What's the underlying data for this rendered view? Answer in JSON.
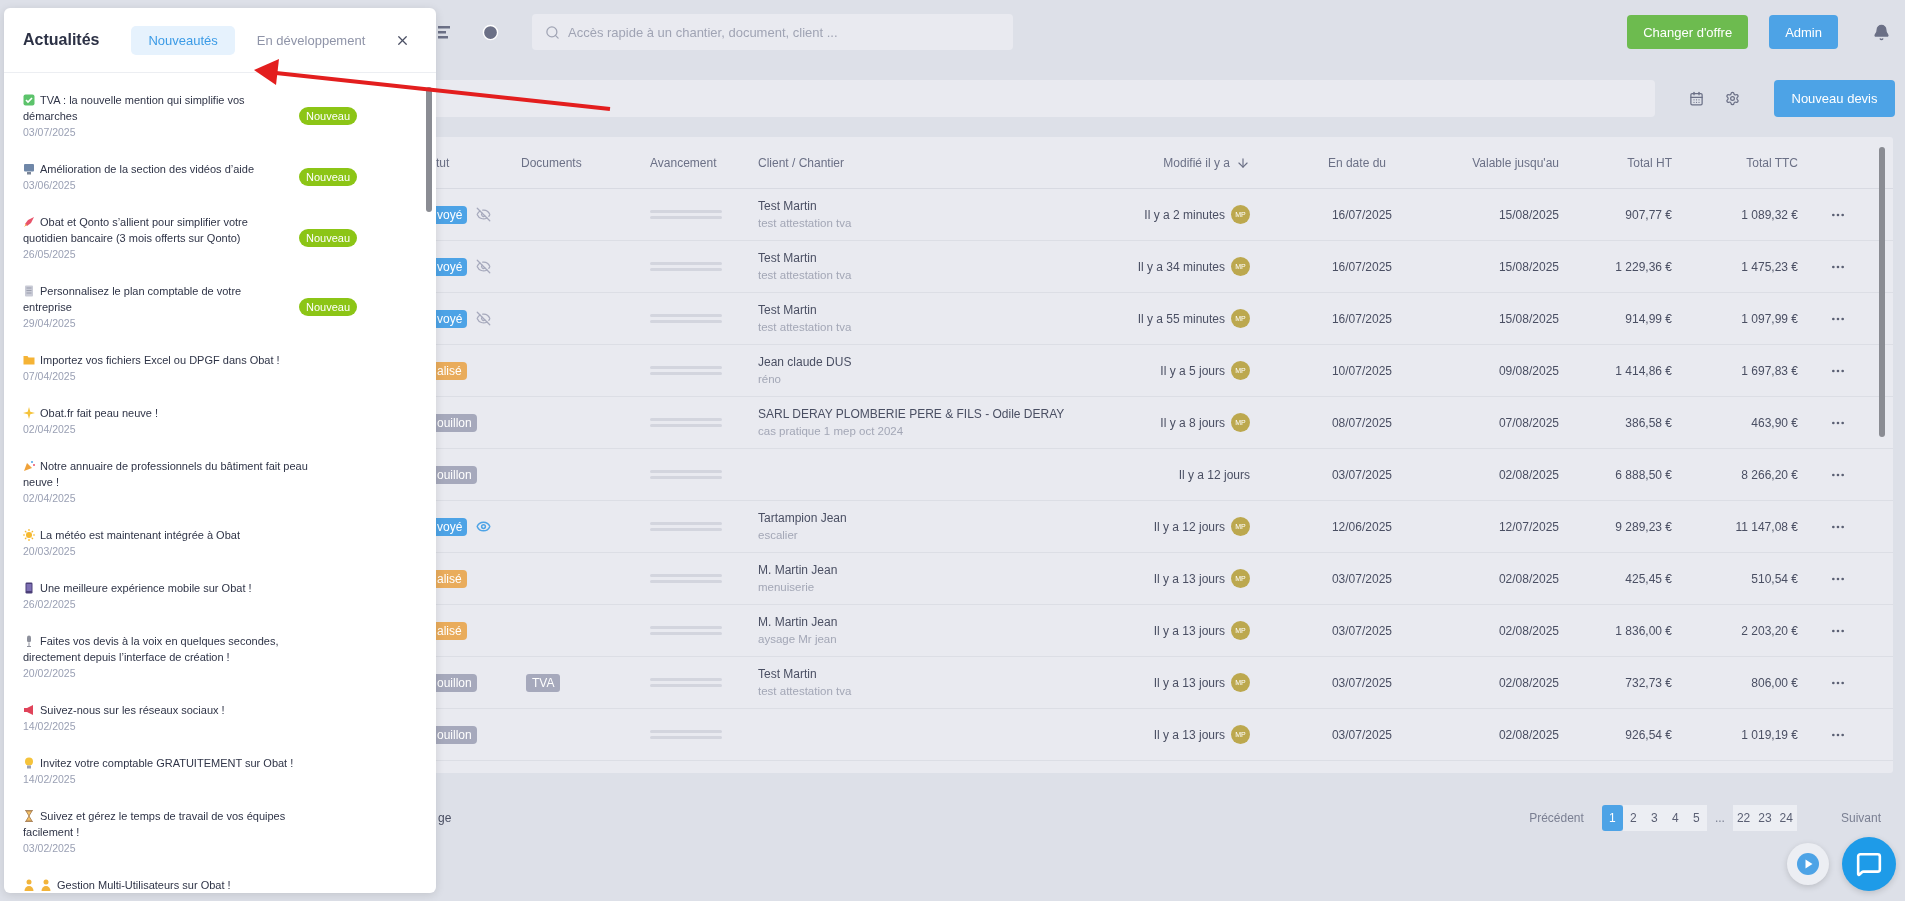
{
  "topbar": {
    "search": {
      "placeholder": "Accès rapide à un chantier, document, client ..."
    },
    "buttons": [
      {
        "label": "Changer d'offre",
        "kind": "upgrade"
      },
      {
        "label": "Admin",
        "kind": "admin"
      }
    ]
  },
  "toolbar": {
    "button": "Nouveau devis"
  },
  "table": {
    "columns": [
      {
        "label": "tut",
        "sorted": false
      },
      {
        "label": "Documents",
        "sorted": false
      },
      {
        "label": "Avancement",
        "sorted": false
      },
      {
        "label": "Client / Chantier",
        "sorted": false
      },
      {
        "label": "Modifié il y a",
        "sorted": true
      },
      {
        "label": "En date du",
        "sorted": false
      },
      {
        "label": "Valable jusqu'au",
        "sorted": false
      },
      {
        "label": "Total HT",
        "sorted": false
      },
      {
        "label": "Total TTC",
        "sorted": false
      }
    ],
    "rows": [
      {
        "status": {
          "label": "voyé",
          "color": "#4da3e6"
        },
        "seen": false,
        "client": "Test Martin",
        "site": "test attestation tva",
        "modified": "Il y a 2 minutes",
        "avatar": "MP",
        "date": "16/07/2025",
        "valid": "15/08/2025",
        "ht": "907,77 €",
        "ttc": "1 089,32 €"
      },
      {
        "status": {
          "label": "voyé",
          "color": "#4da3e6"
        },
        "seen": false,
        "client": "Test Martin",
        "site": "test attestation tva",
        "modified": "Il y a 34 minutes",
        "avatar": "MP",
        "date": "16/07/2025",
        "valid": "15/08/2025",
        "ht": "1 229,36 €",
        "ttc": "1 475,23 €"
      },
      {
        "status": {
          "label": "voyé",
          "color": "#4da3e6"
        },
        "seen": false,
        "client": "Test Martin",
        "site": "test attestation tva",
        "modified": "Il y a 55 minutes",
        "avatar": "MP",
        "date": "16/07/2025",
        "valid": "15/08/2025",
        "ht": "914,99 €",
        "ttc": "1 097,99 €"
      },
      {
        "status": {
          "label": "alisé",
          "color": "#e9ac5c"
        },
        "client": "Jean claude DUS",
        "site": "réno",
        "modified": "Il y a 5 jours",
        "avatar": "MP",
        "date": "10/07/2025",
        "valid": "09/08/2025",
        "ht": "1 414,86 €",
        "ttc": "1 697,83 €"
      },
      {
        "status": {
          "label": "ouillon",
          "color": "#a6a9bc"
        },
        "client": "SARL DERAY PLOMBERIE PERE & FILS - Odile DERAY",
        "site": "cas pratique 1 mep oct 2024",
        "modified": "Il y a 8 jours",
        "avatar": "MP",
        "date": "08/07/2025",
        "valid": "07/08/2025",
        "ht": "386,58 €",
        "ttc": "463,90 €"
      },
      {
        "status": {
          "label": "ouillon",
          "color": "#a6a9bc"
        },
        "modified": "Il y a 12 jours",
        "date": "03/07/2025",
        "valid": "02/08/2025",
        "ht": "6 888,50 €",
        "ttc": "8 266,20 €"
      },
      {
        "status": {
          "label": "voyé",
          "color": "#4da3e6"
        },
        "seen": true,
        "client": "Tartampion Jean",
        "site": "escalier",
        "modified": "Il y a 12 jours",
        "avatar": "MP",
        "date": "12/06/2025",
        "valid": "12/07/2025",
        "ht": "9 289,23 €",
        "ttc": "11 147,08 €"
      },
      {
        "status": {
          "label": "alisé",
          "color": "#e9ac5c"
        },
        "client": "M. Martin Jean",
        "site": "menuiserie",
        "modified": "Il y a 13 jours",
        "avatar": "MP",
        "date": "03/07/2025",
        "valid": "02/08/2025",
        "ht": "425,45 €",
        "ttc": "510,54 €"
      },
      {
        "status": {
          "label": "alisé",
          "color": "#e9ac5c"
        },
        "client": "M. Martin Jean",
        "site": "aysage Mr jean",
        "modified": "Il y a 13 jours",
        "avatar": "MP",
        "date": "03/07/2025",
        "valid": "02/08/2025",
        "ht": "1 836,00 €",
        "ttc": "2 203,20 €"
      },
      {
        "status": {
          "label": "ouillon",
          "color": "#a6a9bc"
        },
        "documents": [
          "TVA"
        ],
        "client": "Test Martin",
        "site": "test attestation tva",
        "modified": "Il y a 13 jours",
        "avatar": "MP",
        "date": "03/07/2025",
        "valid": "02/08/2025",
        "ht": "732,73 €",
        "ttc": "806,00 €"
      },
      {
        "status": {
          "label": "ouillon",
          "color": "#a6a9bc"
        },
        "modified": "Il y a 13 jours",
        "avatar": "MP",
        "date": "03/07/2025",
        "valid": "02/08/2025",
        "ht": "926,54 €",
        "ttc": "1 019,19 €"
      }
    ]
  },
  "footer": {
    "text": "ge",
    "pagination": {
      "previous": "Précédent",
      "next": "Suivant",
      "pages": [
        {
          "label": "1",
          "kind": "page",
          "selected": true
        },
        {
          "label": "2",
          "kind": "page",
          "selected": false
        },
        {
          "label": "3",
          "kind": "page",
          "selected": false
        },
        {
          "label": "4",
          "kind": "page",
          "selected": false
        },
        {
          "label": "5",
          "kind": "page",
          "selected": false
        },
        {
          "label": "...",
          "kind": "ellipsis"
        },
        {
          "label": "22",
          "kind": "page",
          "selected": false
        },
        {
          "label": "23",
          "kind": "page",
          "selected": false
        },
        {
          "label": "24",
          "kind": "page",
          "selected": false
        }
      ]
    }
  },
  "news_panel": {
    "title": "Actualités",
    "tabs": [
      {
        "label": "Nouveautés",
        "selected": true
      },
      {
        "label": "En développement",
        "selected": false
      }
    ],
    "items": [
      {
        "kind": "check",
        "title": "TVA : la nouvelle mention qui simplifie vos démarches",
        "date": "03/07/2025",
        "badge": "Nouveau"
      },
      {
        "kind": "monitor",
        "title": "Amélioration de la section des vidéos d’aide",
        "date": "03/06/2025",
        "badge": "Nouveau"
      },
      {
        "kind": "rocket",
        "title": "Obat et Qonto s’allient pour simplifier votre quotidien bancaire (3 mois offerts sur Qonto)",
        "date": "26/05/2025",
        "badge": "Nouveau"
      },
      {
        "kind": "document",
        "title": "Personnalisez le plan comptable de votre entreprise",
        "date": "29/04/2025",
        "badge": "Nouveau"
      },
      {
        "kind": "folder",
        "title": "Importez vos fichiers Excel ou DPGF dans Obat !",
        "date": "07/04/2025"
      },
      {
        "kind": "sparkle",
        "title": "Obat.fr fait peau neuve !",
        "date": "02/04/2025"
      },
      {
        "kind": "party",
        "title": "Notre annuaire de professionnels du bâtiment fait peau neuve !",
        "date": "02/04/2025"
      },
      {
        "kind": "sun",
        "title": "La météo est maintenant intégrée à Obat",
        "date": "20/03/2025"
      },
      {
        "kind": "phone",
        "title": "Une meilleure expérience mobile sur Obat !",
        "date": "26/02/2025"
      },
      {
        "kind": "microphone",
        "title": "Faites vos devis à la voix en quelques secondes, directement depuis l’interface de création !",
        "date": "20/02/2025"
      },
      {
        "kind": "megaphone",
        "title": "Suivez-nous sur les réseaux sociaux !",
        "date": "14/02/2025"
      },
      {
        "kind": "lightbulb",
        "title": "Invitez votre comptable GRATUITEMENT sur Obat !",
        "date": "14/02/2025"
      },
      {
        "kind": "hourglass",
        "title": "Suivez et gérez le temps de travail de vos équipes facilement !",
        "date": "03/02/2025"
      },
      {
        "kind": "team",
        "title": "Gestion Multi-Utilisateurs sur Obat !"
      }
    ]
  }
}
